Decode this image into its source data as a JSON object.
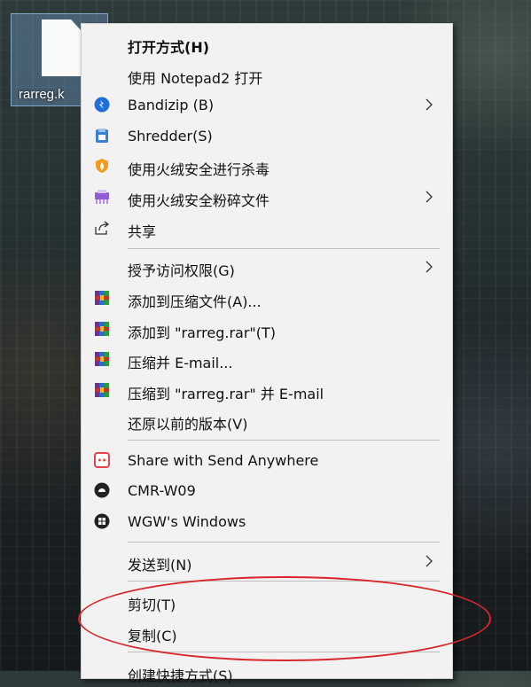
{
  "desktop": {
    "file_label": "rarreg.k"
  },
  "menu": {
    "items": [
      {
        "label": "打开方式(H)",
        "icon": ""
      },
      {
        "label": "使用 Notepad2 打开",
        "icon": ""
      },
      {
        "label": "Bandizip (B)",
        "icon": "bandizip-icon"
      },
      {
        "label": "Shredder(S)",
        "icon": "shredder-icon"
      },
      {
        "label": "使用火绒安全进行杀毒",
        "icon": "huorong-icon"
      },
      {
        "label": "使用火绒安全粉碎文件",
        "icon": "huorong-shred-icon"
      },
      {
        "label": "共享",
        "icon": "share-icon"
      },
      {
        "label": "授予访问权限(G)",
        "icon": ""
      },
      {
        "label": "添加到压缩文件(A)...",
        "icon": "winrar-icon"
      },
      {
        "label": "添加到 \"rarreg.rar\"(T)",
        "icon": "winrar-icon"
      },
      {
        "label": "压缩并 E-mail...",
        "icon": "winrar-icon"
      },
      {
        "label": "压缩到 \"rarreg.rar\" 并 E-mail",
        "icon": "winrar-icon"
      },
      {
        "label": "还原以前的版本(V)",
        "icon": ""
      },
      {
        "label": "Share with Send Anywhere",
        "icon": "send-anywhere-icon"
      },
      {
        "label": "CMR-W09",
        "icon": "android-icon"
      },
      {
        "label": "WGW's Windows",
        "icon": "windows-icon"
      },
      {
        "label": "发送到(N)",
        "icon": ""
      },
      {
        "label": "剪切(T)",
        "icon": ""
      },
      {
        "label": "复制(C)",
        "icon": ""
      },
      {
        "label": "创建快捷方式(S)",
        "icon": ""
      }
    ]
  },
  "colors": {
    "menu_bg": "#f2f2f2",
    "highlight_ellipse": "#d8262a",
    "bandizip": "#1e6fd9",
    "winrar": "#7a2a8c"
  }
}
